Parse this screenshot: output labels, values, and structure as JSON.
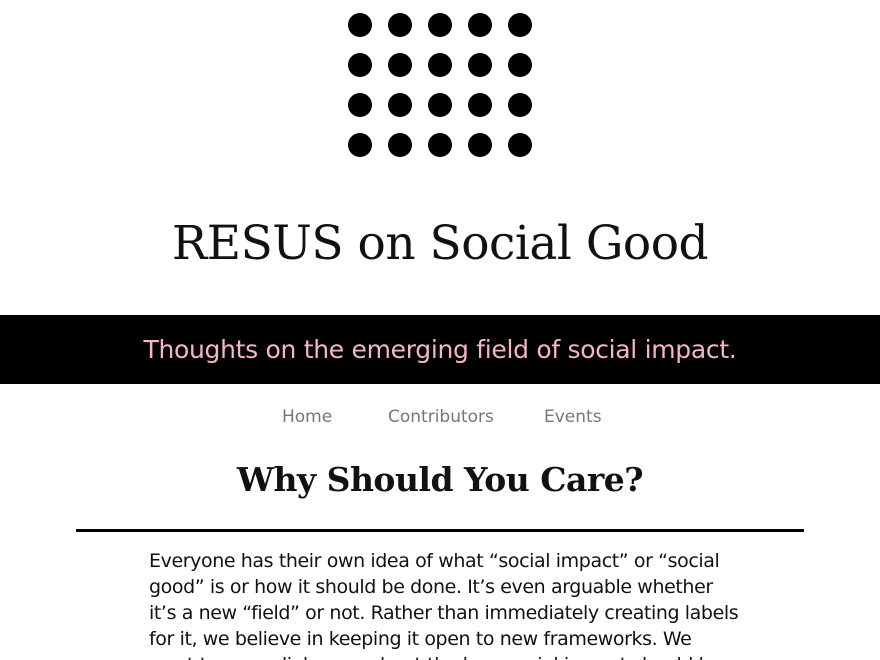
{
  "logo": {
    "icon": "dot-grid-logo",
    "rows": 4,
    "cols": 5,
    "color": "#000000"
  },
  "site": {
    "title": "RESUS on Social Good",
    "tagline": "Thoughts on the emerging field of social impact."
  },
  "nav": {
    "items": [
      {
        "label": "Home"
      },
      {
        "label": "Contributors"
      },
      {
        "label": "Events"
      }
    ]
  },
  "post": {
    "title": "Why Should You Care?",
    "lines": [
      "Everyone has their own idea of what “social impact” or “social",
      "good” is or how it should be done.  It’s even arguable whether",
      "it’s a new “field” or not.  Rather than immediately creating labels",
      "for it, we believe in keeping it open to new frameworks.  We",
      "want to open dialogues about the how social impact should be"
    ]
  },
  "colors": {
    "tagline_bar": "#000000",
    "tagline_text": "#f3b6c2",
    "nav_text": "#777777"
  }
}
